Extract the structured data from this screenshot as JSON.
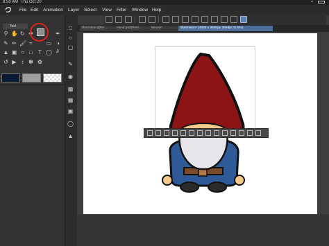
{
  "status_bar": {
    "time": "8:50 AM",
    "date": "Thu Oct 20"
  },
  "menu": [
    "File",
    "Edit",
    "Animation",
    "Layer",
    "Select",
    "View",
    "Filter",
    "Window",
    "Help"
  ],
  "tool_panel": {
    "tab_label": "Tool"
  },
  "doc_tabs": [
    {
      "label": "Illustration3[Re...",
      "active": false
    },
    {
      "label": "Hand.psd(Resi...",
      "active": false
    },
    {
      "label": "Mouse*",
      "active": false
    },
    {
      "label": "Illustration* (4500 x 3500px 300dpi 31.9%)",
      "active": true
    }
  ],
  "colors": {
    "main_color": "#0a1a33",
    "sub_color": "#9e9e9e",
    "highlight": "#e3221b",
    "hat": "#8c1414",
    "coat": "#2f5a98",
    "beard": "#e6e6ea",
    "skin": "#f5c98a",
    "belt": "#7a4a2a"
  }
}
